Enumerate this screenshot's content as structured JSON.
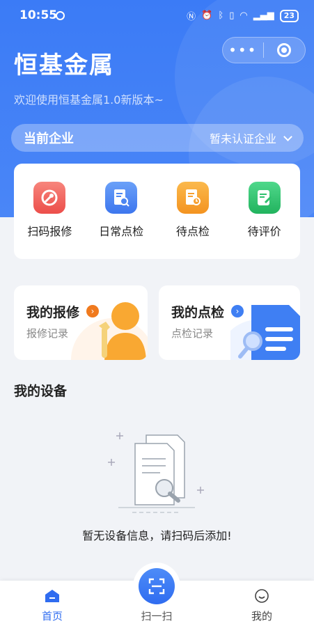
{
  "status_bar": {
    "time": "10:55",
    "battery": "23"
  },
  "app": {
    "title": "恒基金属",
    "subtitle": "欢迎使用恒基金属1.0新版本~"
  },
  "capsule": {
    "more_icon": "more-dots-icon",
    "close_icon": "target-icon"
  },
  "company": {
    "label": "当前企业",
    "value": "暂未认证企业"
  },
  "quick_actions": [
    {
      "label": "扫码报修",
      "icon": "wrench-icon",
      "color": "#f0605a"
    },
    {
      "label": "日常点检",
      "icon": "doc-search-icon",
      "color": "#4c86f2"
    },
    {
      "label": "待点检",
      "icon": "doc-clock-icon",
      "color": "#f7a02e"
    },
    {
      "label": "待评价",
      "icon": "edit-icon",
      "color": "#2fc06e"
    }
  ],
  "cards": [
    {
      "title": "我的报修",
      "subtitle": "报修记录",
      "color": "#f07a1e"
    },
    {
      "title": "我的点检",
      "subtitle": "点检记录",
      "color": "#3f7ff3"
    }
  ],
  "devices": {
    "title": "我的设备",
    "empty_text": "暂无设备信息，请扫码后添加!"
  },
  "tabbar": {
    "home": "首页",
    "scan": "扫一扫",
    "mine": "我的",
    "active_color": "#2f6cf0"
  }
}
